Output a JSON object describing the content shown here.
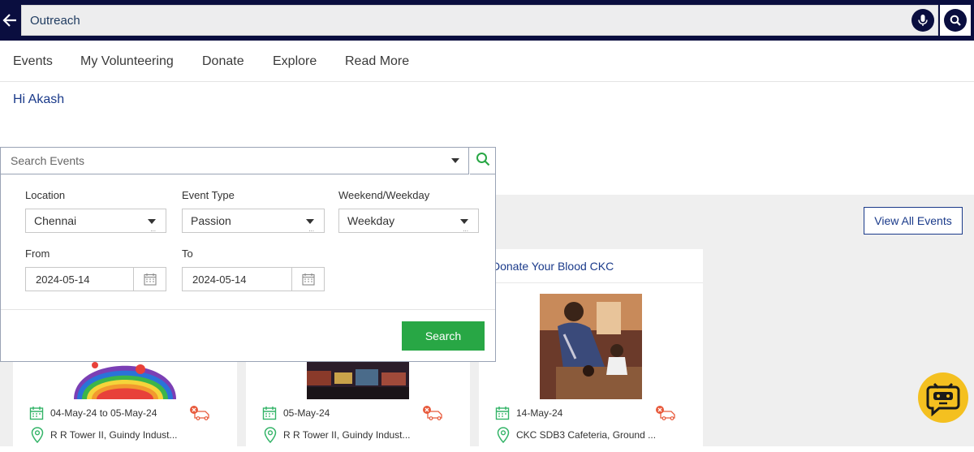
{
  "topbar": {
    "search_value": "Outreach",
    "back_icon": "back-arrow-icon",
    "mic_icon": "microphone-icon",
    "search_icon": "search-icon"
  },
  "nav": {
    "items": [
      "Events",
      "My Volunteering",
      "Donate",
      "Explore",
      "Read More"
    ]
  },
  "greeting": "Hi Akash",
  "search_panel": {
    "placeholder": "Search Events",
    "filters": {
      "location": {
        "label": "Location",
        "value": "Chennai"
      },
      "event_type": {
        "label": "Event Type",
        "value": "Passion"
      },
      "weekend_weekday": {
        "label": "Weekend/Weekday",
        "value": "Weekday"
      },
      "from": {
        "label": "From",
        "value": "2024-05-14"
      },
      "to": {
        "label": "To",
        "value": "2024-05-14"
      }
    },
    "search_button": "Search"
  },
  "view_all_label": "View All Events",
  "cards": [
    {
      "title": "",
      "date": "04-May-24 to 05-May-24",
      "location": "R R Tower II, Guindy Indust..."
    },
    {
      "title": "",
      "date": "05-May-24",
      "location": "R R Tower II, Guindy Indust..."
    },
    {
      "title": "Donate Your Blood CKC",
      "date": "14-May-24",
      "location": "CKC SDB3 Cafeteria, Ground ..."
    }
  ],
  "colors": {
    "topbar": "#0a0e3f",
    "accent_blue": "#1a3a8a",
    "search_green": "#28a745",
    "icon_green": "#34b468",
    "no_vehicle_red": "#e85a3c",
    "bot_yellow": "#f4c020"
  }
}
